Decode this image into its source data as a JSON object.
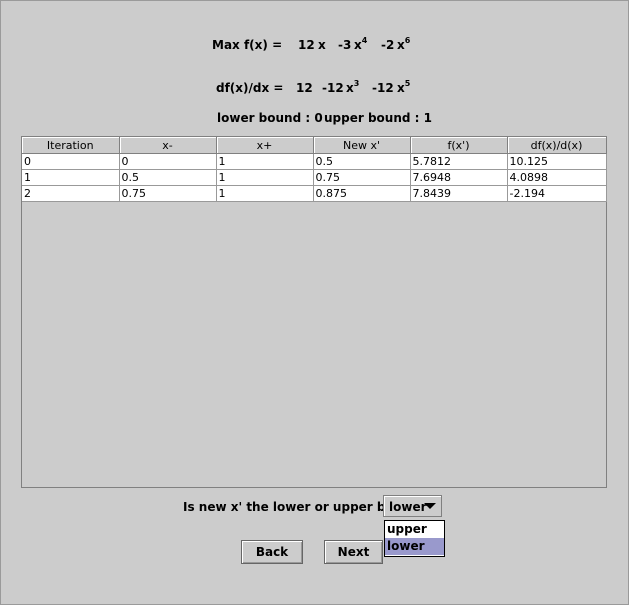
{
  "formula": {
    "max_label": "Max  f(x) =",
    "f_terms": [
      {
        "coef": "12",
        "var": "x",
        "exp": ""
      },
      {
        "coef": "-3",
        "var": "x",
        "exp": "4"
      },
      {
        "coef": "-2",
        "var": "x",
        "exp": "6"
      }
    ],
    "df_label": "df(x)/dx =",
    "df_terms": [
      {
        "coef": "12",
        "var": "",
        "exp": ""
      },
      {
        "coef": "-12",
        "var": "x",
        "exp": "3"
      },
      {
        "coef": "-12",
        "var": "x",
        "exp": "5"
      }
    ]
  },
  "bounds": {
    "lower_label": "lower bound : 0",
    "upper_label": "upper bound : 1"
  },
  "table": {
    "columns": [
      "Iteration",
      "x-",
      "x+",
      "New x'",
      "f(x')",
      "df(x)/d(x)"
    ],
    "rows": [
      [
        "0",
        "0",
        "1",
        "0.5",
        "5.7812",
        "10.125"
      ],
      [
        "1",
        "0.5",
        "1",
        "0.75",
        "7.6948",
        "4.0898"
      ],
      [
        "2",
        "0.75",
        "1",
        "0.875",
        "7.8439",
        "-2.194"
      ]
    ]
  },
  "question": {
    "text": "Is new x' the lower or upper bound",
    "selected": "lower",
    "options": [
      "upper",
      "lower"
    ]
  },
  "buttons": {
    "back": "Back",
    "next": "Next"
  }
}
